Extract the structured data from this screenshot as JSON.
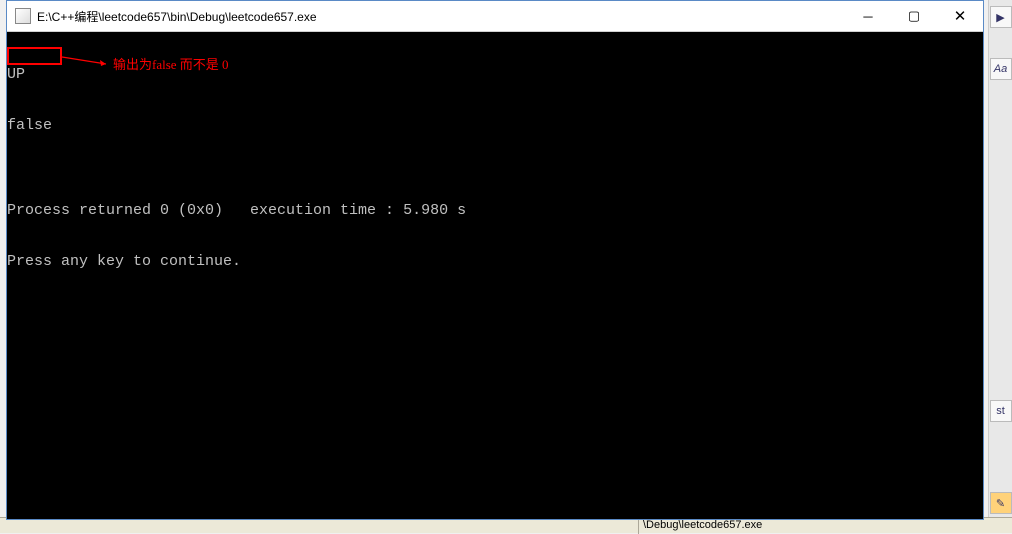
{
  "window": {
    "title": "E:\\C++编程\\leetcode657\\bin\\Debug\\leetcode657.exe"
  },
  "console": {
    "line1": "UP",
    "line2": "false",
    "line3": "",
    "line4": "Process returned 0 (0x0)   execution time : 5.980 s",
    "line5": "Press any key to continue."
  },
  "annotation": {
    "text": "输出为false 而不是 0"
  },
  "background": {
    "status_path": "\\Debug\\leetcode657.exe",
    "side_label1": "Aa",
    "side_label2": "st"
  }
}
